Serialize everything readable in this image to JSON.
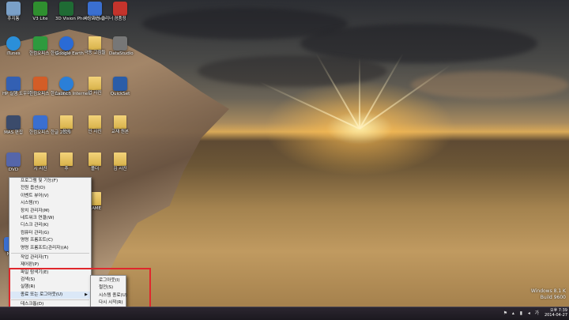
{
  "desktop": {
    "icons": [
      {
        "label": "휴지통",
        "color": "#7aa0c8",
        "icon": "recycle-bin"
      },
      {
        "label": "V3 Lite",
        "color": "#2f8f2f",
        "icon": "v3-lite"
      },
      {
        "label": "3D Vision Photo Viewer",
        "color": "#1f6b34",
        "icon": "photo-viewer"
      },
      {
        "label": "바탕화면 클리너",
        "color": "#3a6fd0",
        "icon": "cleaner"
      },
      {
        "label": "경품정",
        "color": "#c4342c",
        "icon": "app"
      },
      {
        "label": "iTunes",
        "color": "#2b8fd9",
        "icon": "itunes"
      },
      {
        "label": "한컴오피스 한셀 2010",
        "color": "#2e9a3e",
        "icon": "hancell"
      },
      {
        "label": "Google Earth",
        "color": "#2a6bd6",
        "icon": "google-earth"
      },
      {
        "label": "극동 고침들",
        "color": "#d8b24a",
        "icon": "folder"
      },
      {
        "label": "DataStudio",
        "color": "#777777",
        "icon": "datastudio"
      },
      {
        "label": "HP 실행 도우미",
        "color": "#3360b3",
        "icon": "hp"
      },
      {
        "label": "한컴오피스 한쇼 2010",
        "color": "#d35d27",
        "icon": "hanshow"
      },
      {
        "label": "Launch Internet",
        "color": "#2b7fd8",
        "icon": "internet-explorer"
      },
      {
        "label": "업 사진",
        "color": "#d8b24a",
        "icon": "folder"
      },
      {
        "label": "QuickSet",
        "color": "#2a5da8",
        "icon": "quickset"
      },
      {
        "label": "MAS 편집",
        "color": "#3b4b6b",
        "icon": "mas"
      },
      {
        "label": "한컴오피스 한글 2010",
        "color": "#3a6fd0",
        "icon": "hwp"
      },
      {
        "label": "음악",
        "color": "#d8b24a",
        "icon": "folder"
      },
      {
        "label": "인 사진",
        "color": "#d8b24a",
        "icon": "folder"
      },
      {
        "label": "교재 원본",
        "color": "#d8b24a",
        "icon": "folder"
      },
      {
        "label": "DVD",
        "color": "#5566aa",
        "icon": "dvd"
      },
      {
        "label": "시 사진",
        "color": "#d8b24a",
        "icon": "folder"
      },
      {
        "label": "추",
        "color": "#d8b24a",
        "icon": "folder"
      },
      {
        "label": "폴더",
        "color": "#d8b24a",
        "icon": "folder"
      },
      {
        "label": "김 사진",
        "color": "#d8b24a",
        "icon": "folder"
      },
      {
        "label": "GAME",
        "color": "#d8b24a",
        "icon": "folder"
      },
      {
        "label": "Nav",
        "color": "#3a6fd0",
        "icon": "app"
      }
    ]
  },
  "start_menu": {
    "items_top": [
      "프로그램 및 기능(F)",
      "전원 옵션(O)",
      "이벤트 뷰어(V)",
      "시스템(Y)",
      "장치 관리자(M)",
      "네트워크 연결(W)",
      "디스크 관리(K)",
      "컴퓨터 관리(G)",
      "명령 프롬프트(C)",
      "명령 프롬프트(관리자)(A)"
    ],
    "items_mid": [
      "작업 관리자(T)",
      "제어판(P)",
      "파일 탐색기(E)",
      "검색(S)",
      "실행(R)"
    ],
    "shutdown_item": "종료 또는 로그아웃(U)",
    "desktop_item": "데스크톱(D)"
  },
  "submenu": {
    "items": [
      "로그아웃(I)",
      "절전(S)",
      "시스템 종료(U)",
      "다시 시작(R)"
    ]
  },
  "watermark": {
    "line1": "Windows 8.1 K",
    "line2": "Build 9600"
  },
  "taskbar": {
    "ime": "가",
    "time": "오후 7:39",
    "date": "2014-04-27"
  },
  "colors": {
    "highlight_box": "#e0272c",
    "menu_bg": "#f2f2f2",
    "taskbar": "#231f27"
  }
}
